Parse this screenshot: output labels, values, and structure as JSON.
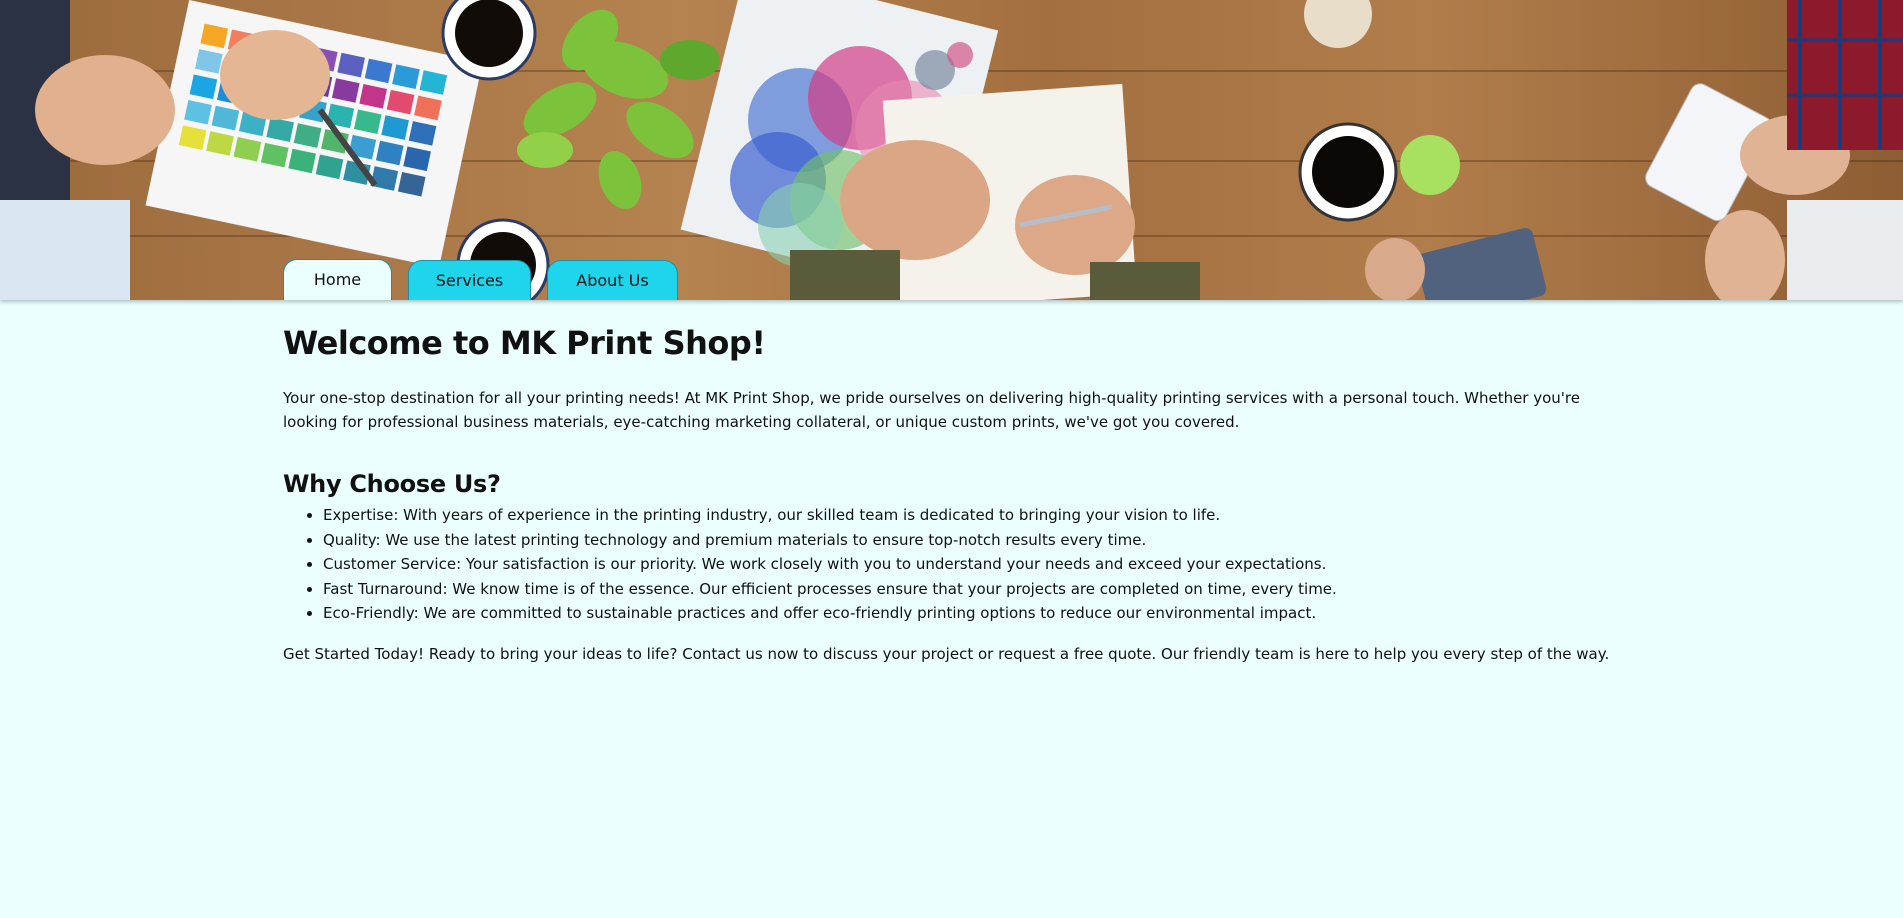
{
  "nav": {
    "tabs": [
      {
        "label": "Home",
        "active": true
      },
      {
        "label": "Services",
        "active": false
      },
      {
        "label": "About Us",
        "active": false
      }
    ]
  },
  "banner": {
    "image_description_icon": "office-desk-photo"
  },
  "main": {
    "title": "Welcome to MK Print Shop!",
    "intro": "Your one-stop destination for all your printing needs! At MK Print Shop, we pride ourselves on delivering high-quality printing services with a personal touch. Whether you're looking for professional business materials, eye-catching marketing collateral, or unique custom prints, we've got you covered.",
    "why_heading": "Why Choose Us?",
    "why_items": [
      "Expertise: With years of experience in the printing industry, our skilled team is dedicated to bringing your vision to life.",
      "Quality: We use the latest printing technology and premium materials to ensure top-notch results every time.",
      "Customer Service: Your satisfaction is our priority. We work closely with you to understand your needs and exceed your expectations.",
      "Fast Turnaround: We know time is of the essence. Our efficient processes ensure that your projects are completed on time, every time.",
      "Eco-Friendly: We are committed to sustainable practices and offer eco-friendly printing options to reduce our environmental impact."
    ],
    "outro": "Get Started Today! Ready to bring your ideas to life? Contact us now to discuss your project or request a free quote. Our friendly team is here to help you every step of the way."
  },
  "colors": {
    "page_background": "#ebffff",
    "tab_background": "#1fd5ec",
    "tab_border": "#1591a8"
  }
}
